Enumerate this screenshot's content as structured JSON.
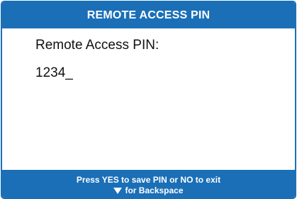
{
  "title_bar": {
    "title": "REMOTE ACCESS PIN"
  },
  "content": {
    "pin_label": "Remote Access PIN:",
    "pin_value": "1234_"
  },
  "footer": {
    "instruction": "Press YES to save PIN or NO to exit",
    "backspace_hint": "for Backspace",
    "backspace_icon": "down-arrow-icon"
  },
  "colors": {
    "accent": "#1a6fb7",
    "background": "#ffffff",
    "text": "#111111"
  }
}
